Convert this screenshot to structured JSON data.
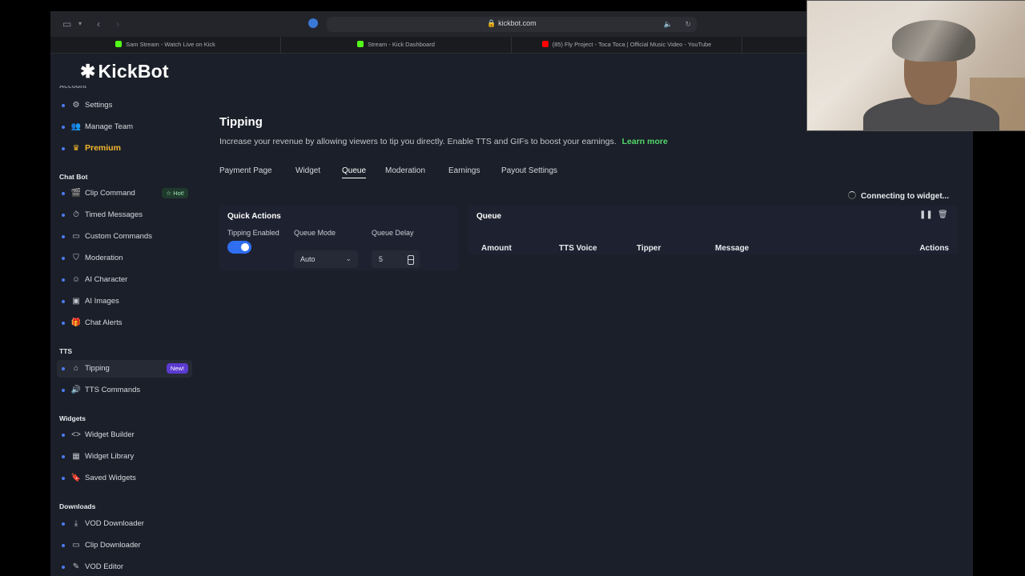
{
  "browser": {
    "url": "kickbot.com",
    "tabs": [
      {
        "label": "Sam Stream - Watch Live on Kick",
        "favicon_color": "#53fc18"
      },
      {
        "label": "Stream - Kick Dashboard",
        "favicon_color": "#53fc18"
      },
      {
        "label": "(85) Fly Project - Toca Toca | Official Music Video - YouTube",
        "favicon_color": "#ff0000"
      }
    ]
  },
  "sidebar": {
    "logo": "KickBot",
    "cut_section": "Account",
    "account_items": [
      {
        "label": "Settings",
        "icon": "gear-icon"
      },
      {
        "label": "Manage Team",
        "icon": "team-icon"
      },
      {
        "label": "Premium",
        "icon": "crown-icon"
      }
    ],
    "chatbot_title": "Chat Bot",
    "chatbot_items": [
      {
        "label": "Clip Command",
        "icon": "clapper-icon",
        "badge": "Hot!"
      },
      {
        "label": "Timed Messages",
        "icon": "timer-icon"
      },
      {
        "label": "Custom Commands",
        "icon": "terminal-icon"
      },
      {
        "label": "Moderation",
        "icon": "shield-icon"
      },
      {
        "label": "AI Character",
        "icon": "robot-icon"
      },
      {
        "label": "AI Images",
        "icon": "image-icon"
      },
      {
        "label": "Chat Alerts",
        "icon": "gift-icon"
      }
    ],
    "tts_title": "TTS",
    "tts_items": [
      {
        "label": "Tipping",
        "icon": "store-icon",
        "badge": "New!"
      },
      {
        "label": "TTS Commands",
        "icon": "speaker-icon"
      }
    ],
    "widgets_title": "Widgets",
    "widget_items": [
      {
        "label": "Widget Builder",
        "icon": "code-icon"
      },
      {
        "label": "Widget Library",
        "icon": "grid-icon"
      },
      {
        "label": "Saved Widgets",
        "icon": "bookmark-icon"
      }
    ],
    "downloads_title": "Downloads",
    "download_items": [
      {
        "label": "VOD Downloader",
        "icon": "download-icon"
      },
      {
        "label": "Clip Downloader",
        "icon": "clip-icon"
      },
      {
        "label": "VOD Editor",
        "icon": "pencil-icon"
      }
    ]
  },
  "page": {
    "title": "Tipping",
    "subtitle": "Increase your revenue by allowing viewers to tip you directly. Enable TTS and GIFs to boost your earnings.",
    "learn_more": "Learn more",
    "tabs": [
      "Payment Page",
      "Widget",
      "Queue",
      "Moderation",
      "Earnings",
      "Payout Settings"
    ],
    "active_tab": "Queue",
    "connecting": "Connecting to widget...",
    "quick_actions": {
      "title": "Quick Actions",
      "tipping_label": "Tipping Enabled",
      "tipping_enabled": true,
      "mode_label": "Queue Mode",
      "mode_value": "Auto",
      "delay_label": "Queue Delay",
      "delay_value": "5"
    },
    "queue": {
      "title": "Queue",
      "columns": [
        "Amount",
        "TTS Voice",
        "Tipper",
        "Message",
        "Actions"
      ]
    }
  },
  "colors": {
    "accent": "#2f6ef0",
    "premium": "#f5b82e",
    "learn_more": "#53d769",
    "badge_new": "#5b3bd1"
  }
}
